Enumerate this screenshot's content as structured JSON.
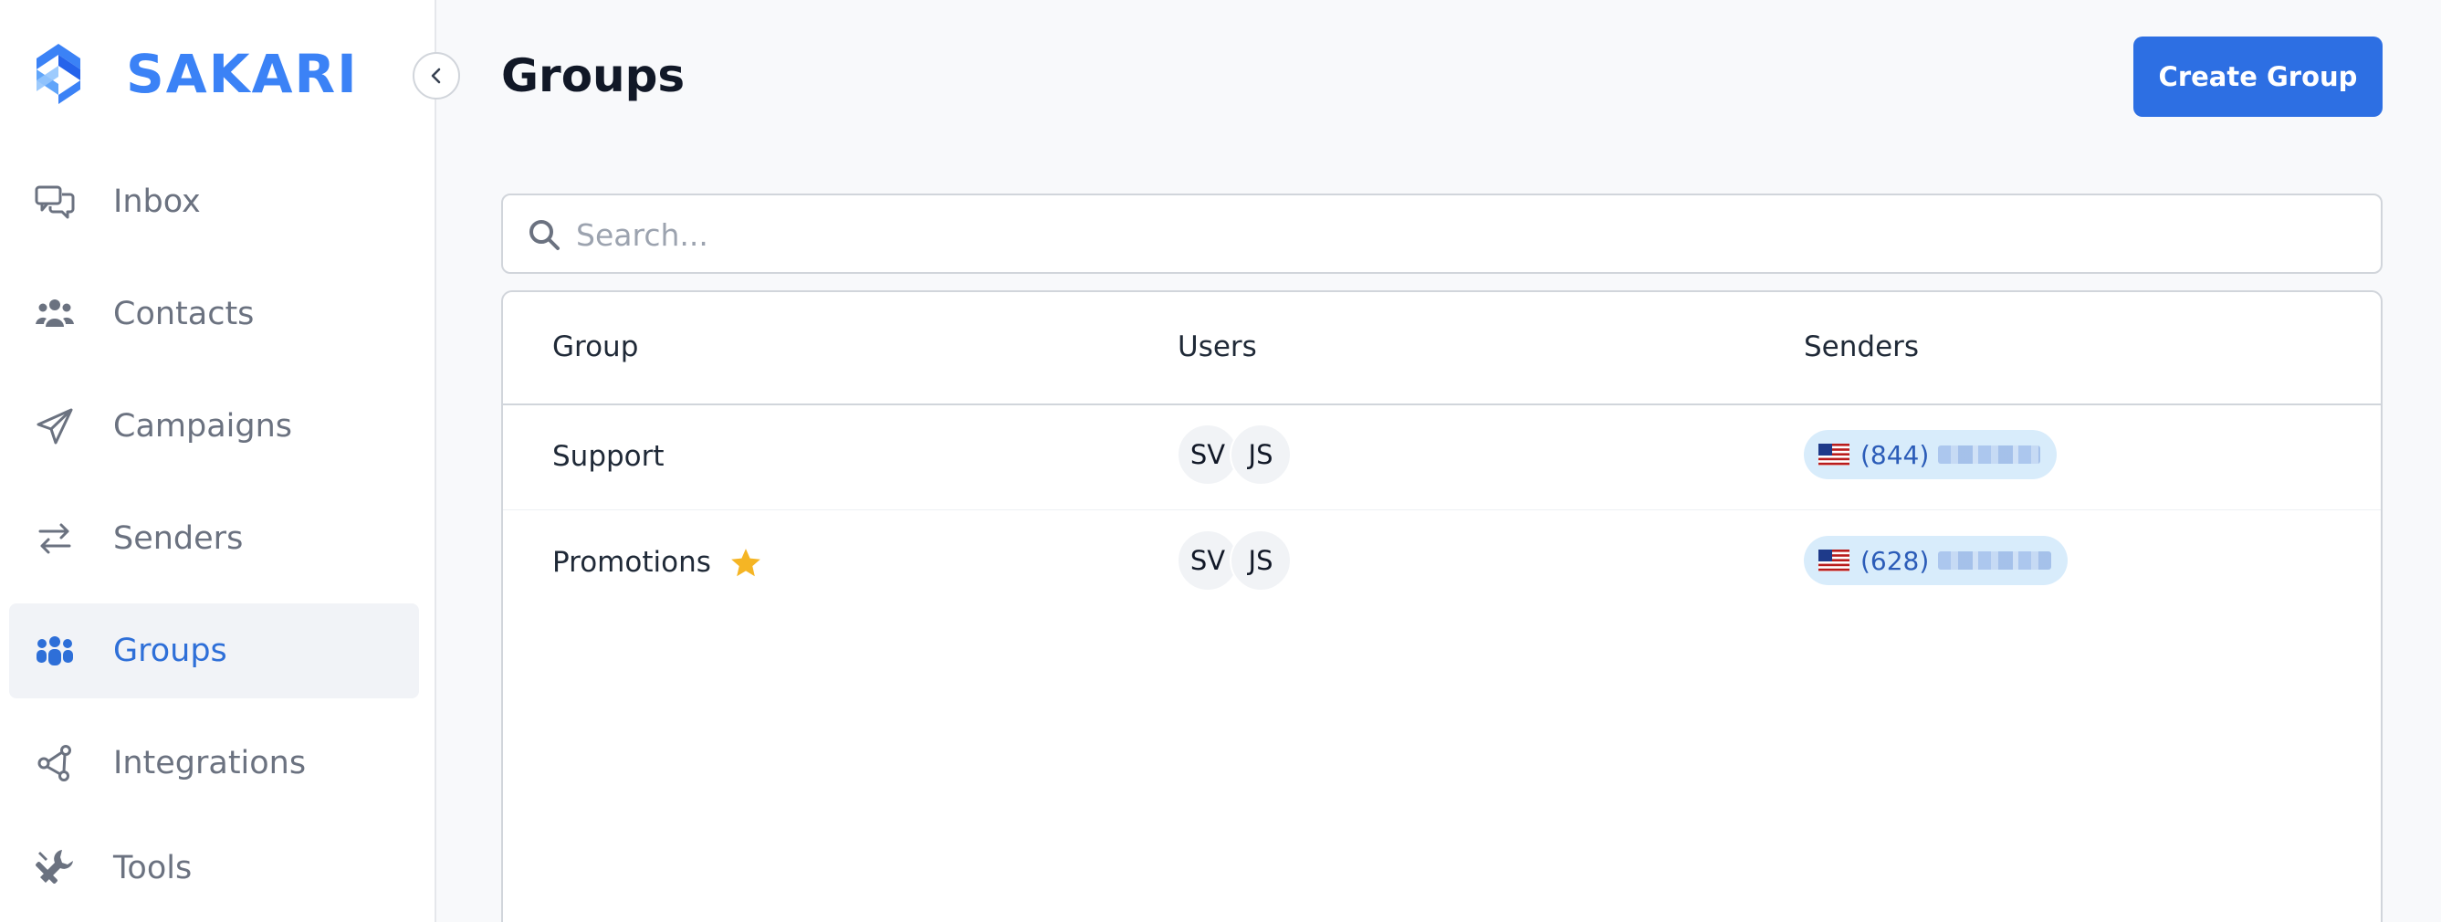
{
  "app": {
    "brand": "SAKARI",
    "brand_color": "#3b82f6",
    "accent": "#2d6fe3"
  },
  "sidebar": {
    "items": [
      {
        "label": "Inbox",
        "icon": "chat-bubbles-icon",
        "active": false
      },
      {
        "label": "Contacts",
        "icon": "people-icon",
        "active": false
      },
      {
        "label": "Campaigns",
        "icon": "paper-plane-icon",
        "active": false
      },
      {
        "label": "Senders",
        "icon": "swap-arrows-icon",
        "active": false
      },
      {
        "label": "Groups",
        "icon": "group-icon",
        "active": true
      },
      {
        "label": "Integrations",
        "icon": "nodes-icon",
        "active": false
      },
      {
        "label": "Tools",
        "icon": "tools-icon",
        "active": false
      }
    ],
    "collapse_icon": "chevron-left-icon"
  },
  "header": {
    "title": "Groups",
    "create_button": "Create Group"
  },
  "search": {
    "placeholder": "Search...",
    "value": ""
  },
  "table": {
    "columns": [
      "Group",
      "Users",
      "Senders"
    ],
    "rows": [
      {
        "group": "Support",
        "starred": false,
        "users": [
          "SV",
          "JS"
        ],
        "sender": {
          "country": "US",
          "number_prefix": "(844)"
        }
      },
      {
        "group": "Promotions",
        "starred": true,
        "users": [
          "SV",
          "JS"
        ],
        "sender": {
          "country": "US",
          "number_prefix": "(628)"
        }
      }
    ]
  }
}
